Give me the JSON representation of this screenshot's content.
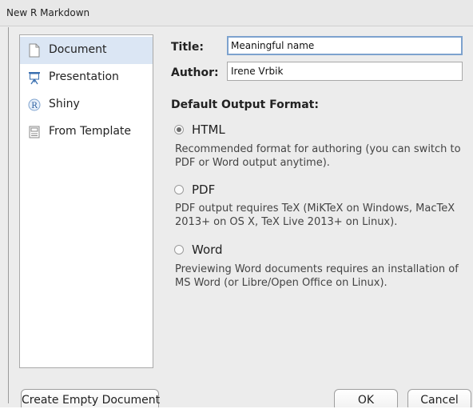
{
  "window": {
    "title": "New R Markdown"
  },
  "sidebar": {
    "items": [
      {
        "label": "Document",
        "icon": "document-icon",
        "selected": true
      },
      {
        "label": "Presentation",
        "icon": "presentation-icon",
        "selected": false
      },
      {
        "label": "Shiny",
        "icon": "shiny-r-icon",
        "selected": false
      },
      {
        "label": "From Template",
        "icon": "template-icon",
        "selected": false
      }
    ]
  },
  "form": {
    "title_label": "Title:",
    "title_value": "Meaningful name",
    "author_label": "Author:",
    "author_value": "Irene Vrbik"
  },
  "output_format": {
    "heading": "Default Output Format:",
    "options": [
      {
        "label": "HTML",
        "checked": true,
        "description": "Recommended format for authoring (you can switch to PDF or Word output anytime)."
      },
      {
        "label": "PDF",
        "checked": false,
        "description": "PDF output requires TeX (MiKTeX on Windows, MacTeX 2013+ on OS X, TeX Live 2013+ on Linux)."
      },
      {
        "label": "Word",
        "checked": false,
        "description": "Previewing Word documents requires an installation of MS Word (or Libre/Open Office on Linux)."
      }
    ]
  },
  "buttons": {
    "create_empty": "Create Empty Document",
    "ok": "OK",
    "cancel": "Cancel"
  },
  "colors": {
    "selection": "#dbe6f4",
    "focus_ring": "#7da2ce",
    "window_bg": "#ececec"
  }
}
